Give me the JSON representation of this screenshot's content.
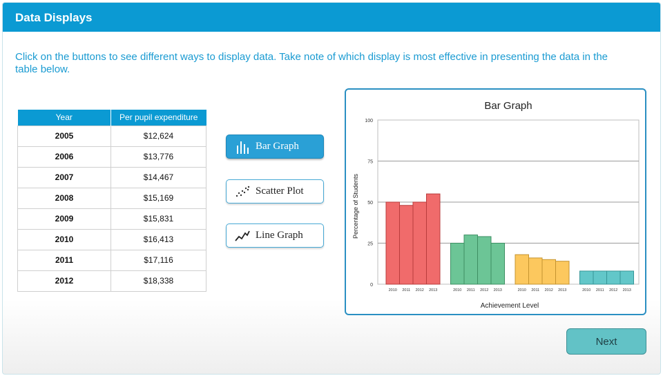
{
  "header": {
    "title": "Data Displays"
  },
  "instructions": "Click on the buttons to see different ways to display data. Take note of which display is most effective in presenting the data in the table below.",
  "table": {
    "headers": [
      "Year",
      "Per pupil expenditure"
    ],
    "rows": [
      [
        "2005",
        "$12,624"
      ],
      [
        "2006",
        "$13,776"
      ],
      [
        "2007",
        "$14,467"
      ],
      [
        "2008",
        "$15,169"
      ],
      [
        "2009",
        "$15,831"
      ],
      [
        "2010",
        "$16,413"
      ],
      [
        "2011",
        "$17,116"
      ],
      [
        "2012",
        "$18,338"
      ]
    ]
  },
  "buttons": {
    "bar_graph": "Bar Graph",
    "scatter_plot": "Scatter Plot",
    "line_graph": "Line Graph",
    "next": "Next"
  },
  "chart_data": {
    "type": "bar",
    "title": "Bar Graph",
    "xlabel": "Achievement Level",
    "ylabel": "Percentage of Students",
    "ylim": [
      0,
      100
    ],
    "yticks": [
      0,
      25,
      50,
      75,
      100
    ],
    "grid": true,
    "groups": [
      {
        "color": "#f06b6b",
        "stroke": "#b83c3c",
        "labels": [
          "2010",
          "2011",
          "2012",
          "2013"
        ],
        "values": [
          50,
          48,
          50,
          55
        ]
      },
      {
        "color": "#6cc596",
        "stroke": "#3e8f63",
        "labels": [
          "2010",
          "2011",
          "2012",
          "2013"
        ],
        "values": [
          25,
          30,
          29,
          25
        ]
      },
      {
        "color": "#fcc85e",
        "stroke": "#c59430",
        "labels": [
          "2010",
          "2011",
          "2012",
          "2013"
        ],
        "values": [
          18,
          16,
          15,
          14
        ]
      },
      {
        "color": "#62c7c9",
        "stroke": "#369597",
        "labels": [
          "2010",
          "2011",
          "2012",
          "2013"
        ],
        "values": [
          8,
          8,
          8,
          8
        ]
      }
    ]
  }
}
